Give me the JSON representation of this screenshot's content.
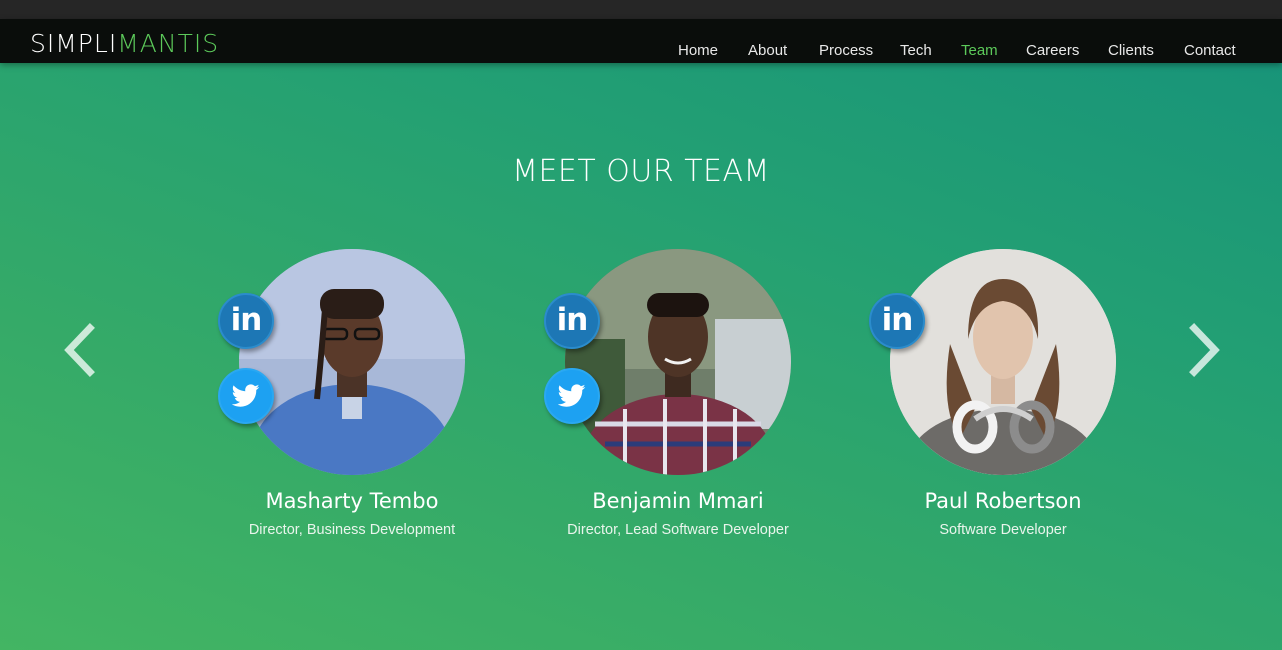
{
  "brand": {
    "part1": "SIMPLI",
    "part2": "MANTIS"
  },
  "nav": {
    "items": [
      {
        "label": "Home"
      },
      {
        "label": "About"
      },
      {
        "label": "Process"
      },
      {
        "label": "Tech"
      },
      {
        "label": "Team",
        "active": true
      },
      {
        "label": "Careers"
      },
      {
        "label": "Clients"
      },
      {
        "label": "Contact"
      }
    ]
  },
  "team": {
    "title": "MEET OUR TEAM",
    "members": [
      {
        "name": "Masharty Tembo",
        "role": "Director, Business Development",
        "social": [
          "linkedin",
          "twitter"
        ]
      },
      {
        "name": "Benjamin Mmari",
        "role": "Director, Lead Software Developer",
        "social": [
          "linkedin",
          "twitter"
        ]
      },
      {
        "name": "Paul Robertson",
        "role": "Software Developer",
        "social": [
          "linkedin"
        ]
      }
    ]
  },
  "colors": {
    "accent": "#5cc95a",
    "navbar": "#0a0d0b",
    "linkedin": "#1d77b5",
    "twitter": "#1da1f2"
  },
  "icons": {
    "prev": "chevron-left-icon",
    "next": "chevron-right-icon",
    "linkedin": "linkedin-icon",
    "twitter": "twitter-icon"
  }
}
